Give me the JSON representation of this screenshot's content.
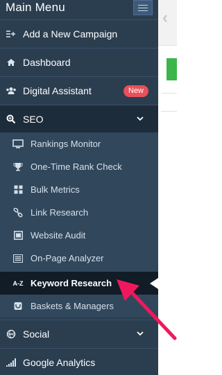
{
  "menu": {
    "title": "Main Menu"
  },
  "items": {
    "add_campaign": "Add a New Campaign",
    "dashboard": "Dashboard",
    "digital_assistant": "Digital Assistant",
    "digital_assistant_badge": "New",
    "seo": "SEO",
    "social": "Social",
    "google_analytics": "Google Analytics"
  },
  "seo_submenu": [
    {
      "label": "Rankings Monitor",
      "icon": "monitor-icon"
    },
    {
      "label": "One-Time Rank Check",
      "icon": "trophy-icon"
    },
    {
      "label": "Bulk Metrics",
      "icon": "grid-icon"
    },
    {
      "label": "Link Research",
      "icon": "link-icon"
    },
    {
      "label": "Website Audit",
      "icon": "audit-icon"
    },
    {
      "label": "On-Page Analyzer",
      "icon": "list-icon"
    },
    {
      "label": "Keyword Research",
      "icon": "az-icon",
      "active": true
    },
    {
      "label": "Baskets & Managers",
      "icon": "basket-icon"
    }
  ],
  "icons": {
    "az_text": "A-Z"
  },
  "colors": {
    "sidebar_bg": "#2b3e50",
    "active_bg": "#111c27",
    "badge": "#e8505b",
    "arrow": "#f0185d",
    "green": "#3cb54a"
  }
}
